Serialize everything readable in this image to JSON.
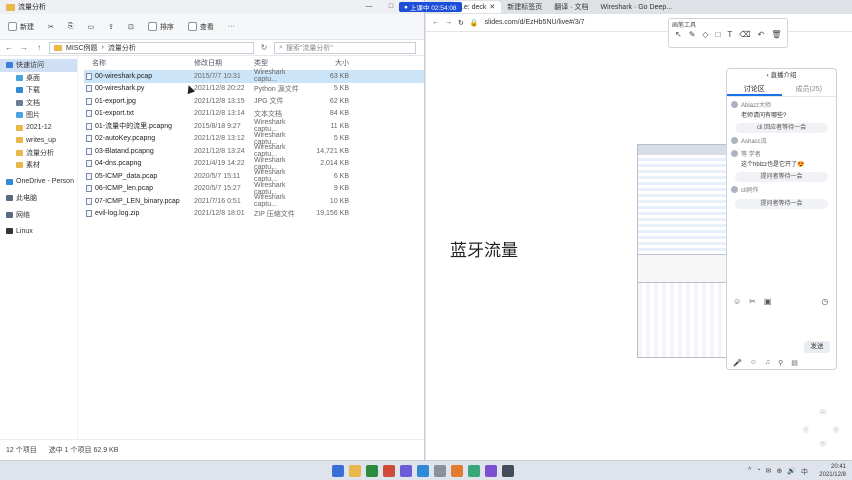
{
  "explorer": {
    "window_title": "流量分析",
    "window_controls": [
      "—",
      "□",
      "✕"
    ],
    "ribbon": [
      "新建",
      "✂",
      "⎘",
      "▭",
      "⇪",
      "⊡",
      "排序",
      "查看",
      "···"
    ],
    "path": [
      "MISC例题",
      "流量分析"
    ],
    "search_placeholder": "搜索\"流量分析\"",
    "columns": {
      "name": "名称",
      "date": "修改日期",
      "type": "类型",
      "size": "大小"
    },
    "files": [
      {
        "name": "00-wireshark.pcap",
        "date": "2015/7/7 10:31",
        "type": "Wireshark captu...",
        "size": "63 KB",
        "selected": true
      },
      {
        "name": "00-wireshark.py",
        "date": "2021/12/8 20:22",
        "type": "Python 源文件",
        "size": "5 KB"
      },
      {
        "name": "01-export.jpg",
        "date": "2021/12/8 13:15",
        "type": "JPG 文件",
        "size": "62 KB"
      },
      {
        "name": "01-export.txt",
        "date": "2021/12/8 13:14",
        "type": "文本文档",
        "size": "84 KB"
      },
      {
        "name": "01-流量中的流里.pcapng",
        "date": "2015/8/18 9:27",
        "type": "Wireshark captu...",
        "size": "11 KB"
      },
      {
        "name": "02-autoKey.pcapng",
        "date": "2021/12/8 13:12",
        "type": "Wireshark captu...",
        "size": "5 KB"
      },
      {
        "name": "03-Blatand.pcapng",
        "date": "2021/12/8 13:24",
        "type": "Wireshark captu...",
        "size": "14,721 KB"
      },
      {
        "name": "04-dns.pcapng",
        "date": "2021/4/19 14:22",
        "type": "Wireshark captu...",
        "size": "2,014 KB"
      },
      {
        "name": "05-ICMP_data.pcap",
        "date": "2020/5/7 15:11",
        "type": "Wireshark captu...",
        "size": "6 KB"
      },
      {
        "name": "06-ICMP_len.pcap",
        "date": "2020/5/7 15:27",
        "type": "Wireshark captu...",
        "size": "9 KB"
      },
      {
        "name": "07-ICMP_LEN_binary.pcap",
        "date": "2021/7/16 0:51",
        "type": "Wireshark captu...",
        "size": "10 KB"
      },
      {
        "name": "evil-log.log.zip",
        "date": "2021/12/8 18:01",
        "type": "ZIP 压缩文件",
        "size": "19,156 KB"
      }
    ],
    "sidebar": [
      {
        "label": "快速访问",
        "color": "#3b7dd8",
        "kind": "active"
      },
      {
        "label": "桌面",
        "color": "#4aa3df"
      },
      {
        "label": "下载",
        "color": "#2f8ad8"
      },
      {
        "label": "文档",
        "color": "#6b7c93"
      },
      {
        "label": "图片",
        "color": "#4aa3df"
      },
      {
        "label": "2021-12",
        "color": "#e8b94a"
      },
      {
        "label": "writes_up",
        "color": "#e8b94a"
      },
      {
        "label": "流量分析",
        "color": "#e8b94a"
      },
      {
        "label": "素材",
        "color": "#e8b94a"
      },
      {
        "label": "OneDrive - Person",
        "color": "#2f8ad8",
        "kind": "top"
      },
      {
        "label": "此电脑",
        "color": "#5a6b82",
        "kind": "top"
      },
      {
        "label": "网络",
        "color": "#5a6b82",
        "kind": "top"
      },
      {
        "label": "Linux",
        "color": "#333333",
        "kind": "top"
      }
    ],
    "status": {
      "count": "12 个项目",
      "selection": "选中 1 个项目 62.9 KB"
    }
  },
  "browser": {
    "recording": "上课中 02:54:08",
    "tabs": [
      "...e: deck",
      "新建标签页",
      "翻译 · 文档",
      "Wireshark · Go Deep..."
    ],
    "url": "slides.com/d/EzHb5NU/live#/3/7",
    "slide_title": "蓝牙流量"
  },
  "draw_tools": {
    "title": "画笔工具",
    "icons": [
      "↖",
      "✎",
      "◇",
      "□",
      "T",
      "⌫",
      "↶",
      "🗑"
    ]
  },
  "chat": {
    "header": "‹ 直播介绍",
    "tabs": [
      "讨论区",
      "成员(25)"
    ],
    "messages": [
      {
        "name": "Ablazz大师",
        "text": "老师请问有哪些?"
      },
      {
        "pill": "cli 回应者等待一会"
      },
      {
        "name": "Ashacc流",
        "text": ""
      },
      {
        "name": "等 学者",
        "text": "这个hblzz也是它开了😍"
      },
      {
        "pill": "提问者等待一会"
      },
      {
        "name": "cll同作",
        "text": ""
      },
      {
        "pill": "提问者等待一会"
      }
    ],
    "tool_icons": [
      "☺",
      "✂",
      "▣",
      "◷"
    ],
    "send_label": "发送",
    "bottom_icons": [
      "🎤",
      "☺",
      "♫",
      "⚲",
      "▤"
    ]
  },
  "taskbar": {
    "app_colors": [
      "#3b6fd8",
      "#e8b94a",
      "#2b8a3e",
      "#d04a3a",
      "#6b5bd6",
      "#2f8ad8",
      "#8a8f99",
      "#e07b2f",
      "#3aa77a",
      "#7a4fd0",
      "#444c5c"
    ],
    "tray": [
      "^",
      "◔",
      "✉",
      "⊕",
      "🔊",
      "中"
    ],
    "time": "20:41",
    "date": "2021/12/8"
  }
}
